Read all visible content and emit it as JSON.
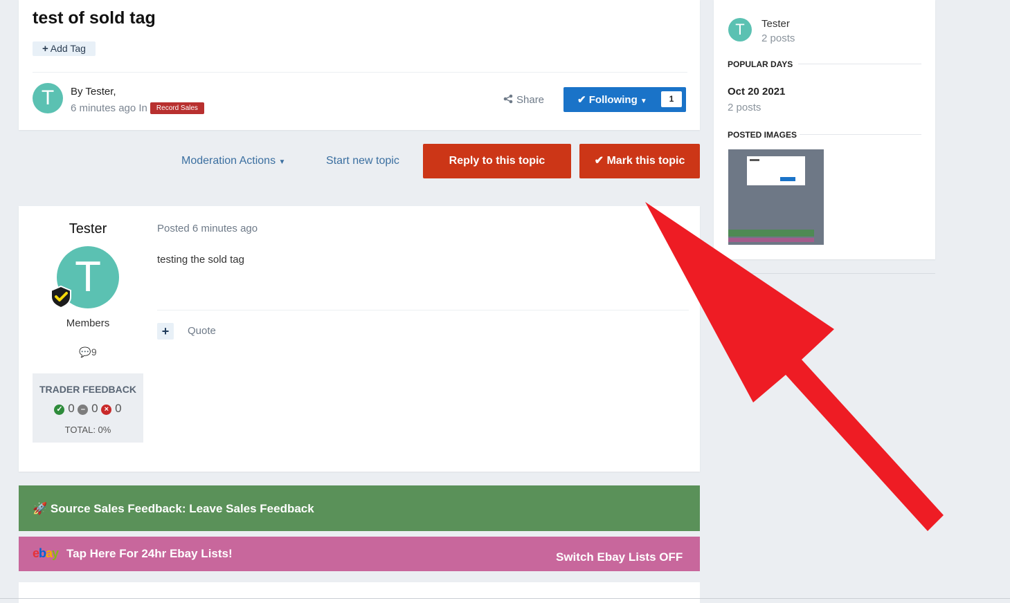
{
  "topic": {
    "title": "test of sold tag",
    "add_tag_label": "Add Tag",
    "author_prefix": "By Tester,",
    "time_text": "6 minutes ago In",
    "forum_badge": "Record Sales",
    "share_label": "Share",
    "following_label": "Following",
    "following_count": "1"
  },
  "actions": {
    "moderation_label": "Moderation Actions",
    "start_topic_label": "Start new topic",
    "reply_label": "Reply to this topic",
    "mark_label": "Mark this topic"
  },
  "post": {
    "author": "Tester",
    "avatar_letter": "T",
    "group": "Members",
    "post_count": "9",
    "posted_time": "Posted 6 minutes ago",
    "content": "testing the sold tag",
    "quote_label": "Quote",
    "feedback": {
      "title": "TRADER FEEDBACK",
      "positive": "0",
      "neutral": "0",
      "negative": "0",
      "total": "TOTAL: 0%"
    }
  },
  "banners": {
    "feedback_text": "Source Sales Feedback: Leave Sales Feedback",
    "ebay_logo": "ebay",
    "ebay_text": "Tap Here For 24hr Ebay Lists!",
    "ebay_switch": "Switch Ebay Lists OFF"
  },
  "sidebar": {
    "top_poster_name": "Tester",
    "top_poster_sub": "2 posts",
    "popular_days_heading": "POPULAR DAYS",
    "popular_day": "Oct 20 2021",
    "popular_day_posts": "2 posts",
    "posted_images_heading": "POSTED IMAGES"
  },
  "colors": {
    "accent_blue": "#1a73c8",
    "reply_red": "#cc3617",
    "feedback_green": "#5a9159",
    "ebay_pink": "#c8679c",
    "avatar_teal": "#5bc1b2",
    "annotation_arrow": "#ee1c24"
  }
}
